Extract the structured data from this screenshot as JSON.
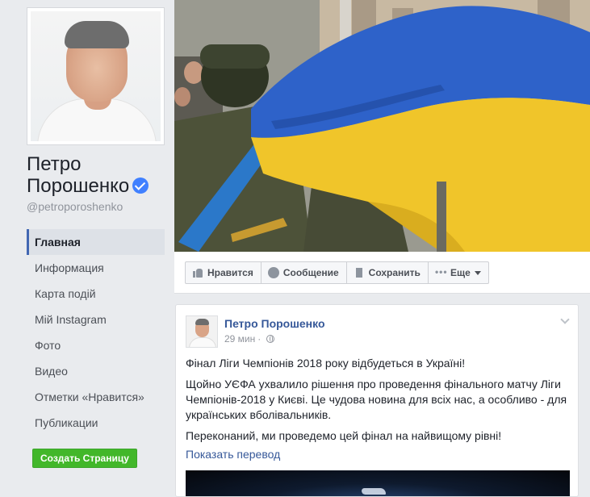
{
  "profile": {
    "name_line1": "Петро",
    "name_line2": "Порошенко",
    "handle": "@petroporoshenko",
    "verified": true
  },
  "nav": {
    "items": [
      {
        "label": "Главная",
        "active": true
      },
      {
        "label": "Информация"
      },
      {
        "label": "Карта подій"
      },
      {
        "label": "Мій Instagram"
      },
      {
        "label": "Фото"
      },
      {
        "label": "Видео"
      },
      {
        "label": "Отметки «Нравится»"
      },
      {
        "label": "Публикации"
      }
    ]
  },
  "create_page_button": "Создать Страницу",
  "actions": {
    "like": "Нравится",
    "message": "Сообщение",
    "save": "Сохранить",
    "more": "Еще"
  },
  "post": {
    "author": "Петро Порошенко",
    "time": "29 мин",
    "paragraphs": [
      "Фінал Ліги Чемпіонів 2018 року відбудеться в Україні!",
      "Щойно УЄФА ухвалило рішення про проведення фінального матчу Ліги Чемпіонів-2018 у Києві. Це чудова новина для всіх нас, а особливо - для українських вболівальників.",
      "Переконаний, ми проведемо цей фінал на найвищому рівні!"
    ],
    "translate_link": "Показать перевод"
  },
  "colors": {
    "flag_blue": "#2e62c9",
    "flag_yellow": "#f0c52a",
    "link": "#365899",
    "accent": "#4267b2",
    "green_button": "#42b72a"
  },
  "icons": [
    "verified-badge-icon",
    "like-icon",
    "message-icon",
    "bookmark-icon",
    "more-dots-icon",
    "caret-down-icon",
    "globe-icon",
    "chevron-down-icon"
  ]
}
